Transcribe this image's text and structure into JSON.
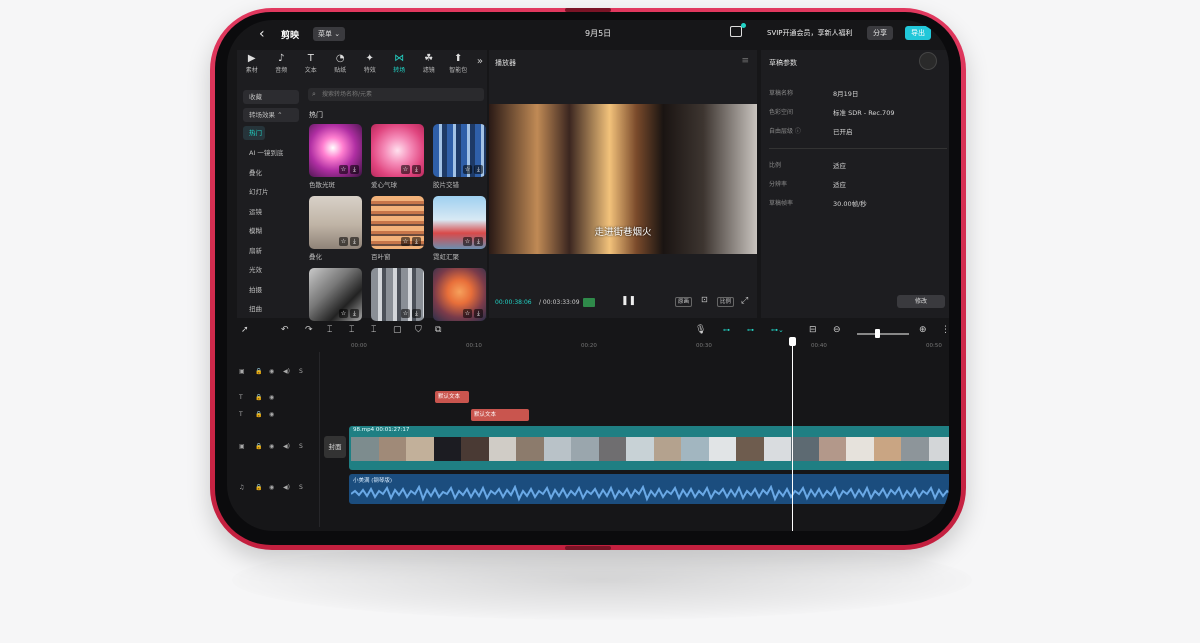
{
  "topbar": {
    "back_icon": "chevron-left-icon",
    "logo": "剪映",
    "menu": "菜单 ⌄",
    "date": "9月5日",
    "vip_text": "SVIP开通会员，享新人福利",
    "share": "分享",
    "export": "导出"
  },
  "tools": [
    {
      "icon": "▶",
      "label": "素材"
    },
    {
      "icon": "♪",
      "label": "音频"
    },
    {
      "icon": "T",
      "label": "文本"
    },
    {
      "icon": "◔",
      "label": "贴纸"
    },
    {
      "icon": "✦",
      "label": "特效"
    },
    {
      "icon": "⋈",
      "label": "转场"
    },
    {
      "icon": "☘",
      "label": "滤镜"
    },
    {
      "icon": "⬆",
      "label": "智能包"
    }
  ],
  "categories": [
    "收藏",
    "转场效果 ⌃",
    "热门",
    "AI 一镜到底",
    "叠化",
    "幻灯片",
    "运镜",
    "模糊",
    "扇新",
    "光效",
    "拍摄",
    "扭曲"
  ],
  "search_placeholder": "搜索转场名称/元素",
  "hot_title": "热门",
  "effects": [
    {
      "label": "色散光斑"
    },
    {
      "label": "爱心气球"
    },
    {
      "label": "胶片交错"
    },
    {
      "label": "叠化"
    },
    {
      "label": "百叶窗"
    },
    {
      "label": "霓虹汇聚"
    },
    {
      "label": ""
    },
    {
      "label": ""
    },
    {
      "label": ""
    }
  ],
  "player": {
    "title": "播放器",
    "subtitle": "走进街巷烟火",
    "current_time": "00:00:38:06",
    "total_time": "/ 00:03:33:09",
    "btn_original": "原画",
    "btn_ratio": "比例"
  },
  "params": {
    "title": "草稿参数",
    "rows": [
      {
        "k": "草稿名称",
        "v": "8月19日"
      },
      {
        "k": "色彩空间",
        "v": "标准 SDR - Rec.709"
      },
      {
        "k": "自由层级 ⓘ",
        "v": "已开启"
      },
      {
        "k": "比例",
        "v": "适应"
      },
      {
        "k": "分辨率",
        "v": "适应"
      },
      {
        "k": "草稿帧率",
        "v": "30.00帧/秒"
      }
    ],
    "edit": "修改"
  },
  "ruler": [
    "00:00",
    "00:10",
    "00:20",
    "00:30",
    "00:40",
    "00:50"
  ],
  "tracks": {
    "text1": "默认文本",
    "text2": "默认文本",
    "video_label": "98.mp4  00:01:27:17",
    "cover": "封面",
    "audio_label": "小美满 (钢琴版)"
  },
  "colors": {
    "accent": "#22d3c5",
    "export": "#21c7d9",
    "video_track": "#1f7f83",
    "audio_track": "#1b4d7e",
    "text_clip": "#c9554e",
    "device": "#d22b4b"
  }
}
